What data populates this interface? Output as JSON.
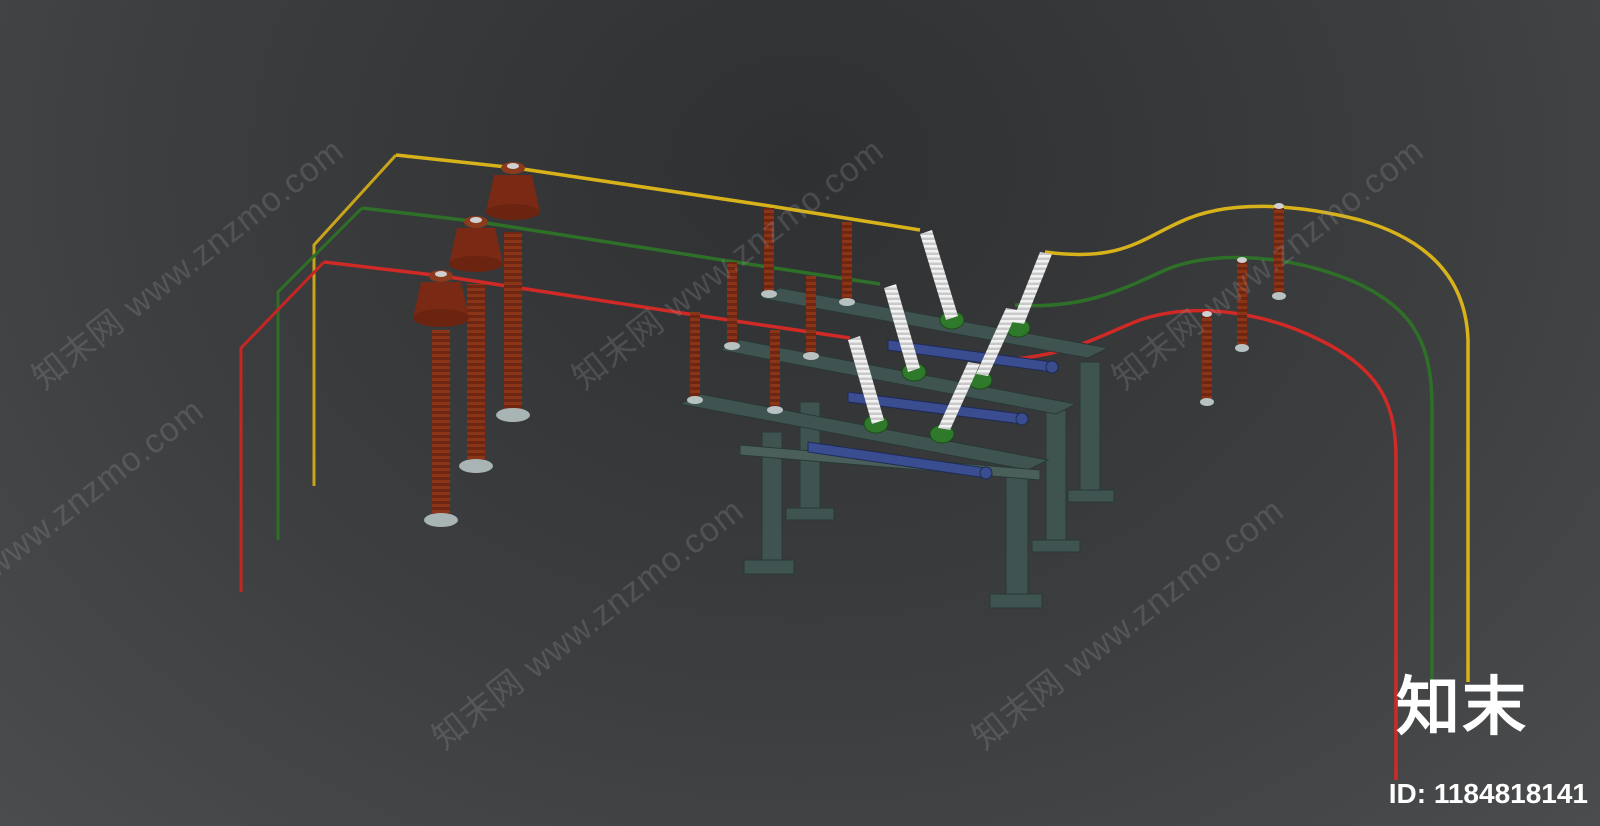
{
  "watermarks": {
    "site_text": "知末网 www.znzmo.com"
  },
  "branding": {
    "logo_text": "知末",
    "id_label": "ID: 1184818141"
  },
  "colors": {
    "background": "#3a3c3e",
    "wire_yellow": "#d8b21a",
    "wire_green": "#2e6e25",
    "wire_red": "#cf2a26",
    "insulator_brown": "#7a2a14",
    "frame_teal": "#3f5450",
    "porcelain_white": "#e8e8e8",
    "conductor_blue": "#3a4d90"
  }
}
